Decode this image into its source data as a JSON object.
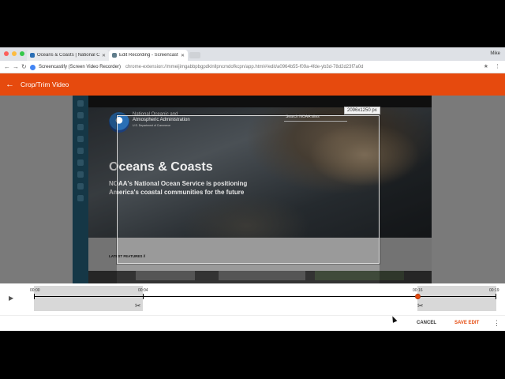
{
  "browser": {
    "tabs": [
      {
        "label": "Oceans & Coasts | National Oc",
        "favicon_color": "#2a6fb5"
      },
      {
        "label": "Edit Recording - Screencast",
        "favicon_color": "#607d8b"
      }
    ],
    "profile_name": "Mike",
    "omnibox": {
      "site_label": "Screencastify (Screen Video Recorder)",
      "url": "chrome-extension://mmeijimgabbpbgpdklnllpncmdofkcpn/app.html#/edit/a0964b55-f09a-4fde-yb3d-78d2d23f7a0d"
    }
  },
  "app": {
    "title": "Crop/Trim Video",
    "accent_color": "#e64a0e"
  },
  "video": {
    "site": {
      "org_name": "National Oceanic and Atmospheric Administration",
      "org_sub": "U.S. Department of Commerce",
      "search_placeholder": "Search NOAA sites",
      "hero_title": "Oceans & Coasts",
      "hero_subtitle": "NOAA's National Ocean Service is positioning America's coastal communities for the future",
      "latest_label": "LATEST FEATURES //"
    },
    "crop_dimensions": "2096x1250 px"
  },
  "timeline": {
    "start_time": "00:00",
    "trim_start": "00:04",
    "trim_end": "00:16",
    "end_time": "00:19"
  },
  "actions": {
    "cancel_label": "CANCEL",
    "save_label": "SAVE EDIT"
  },
  "icons": {
    "back": "arrow-left-icon",
    "play": "play-icon",
    "scissors": "scissors-icon",
    "more": "more-vert-icon"
  }
}
